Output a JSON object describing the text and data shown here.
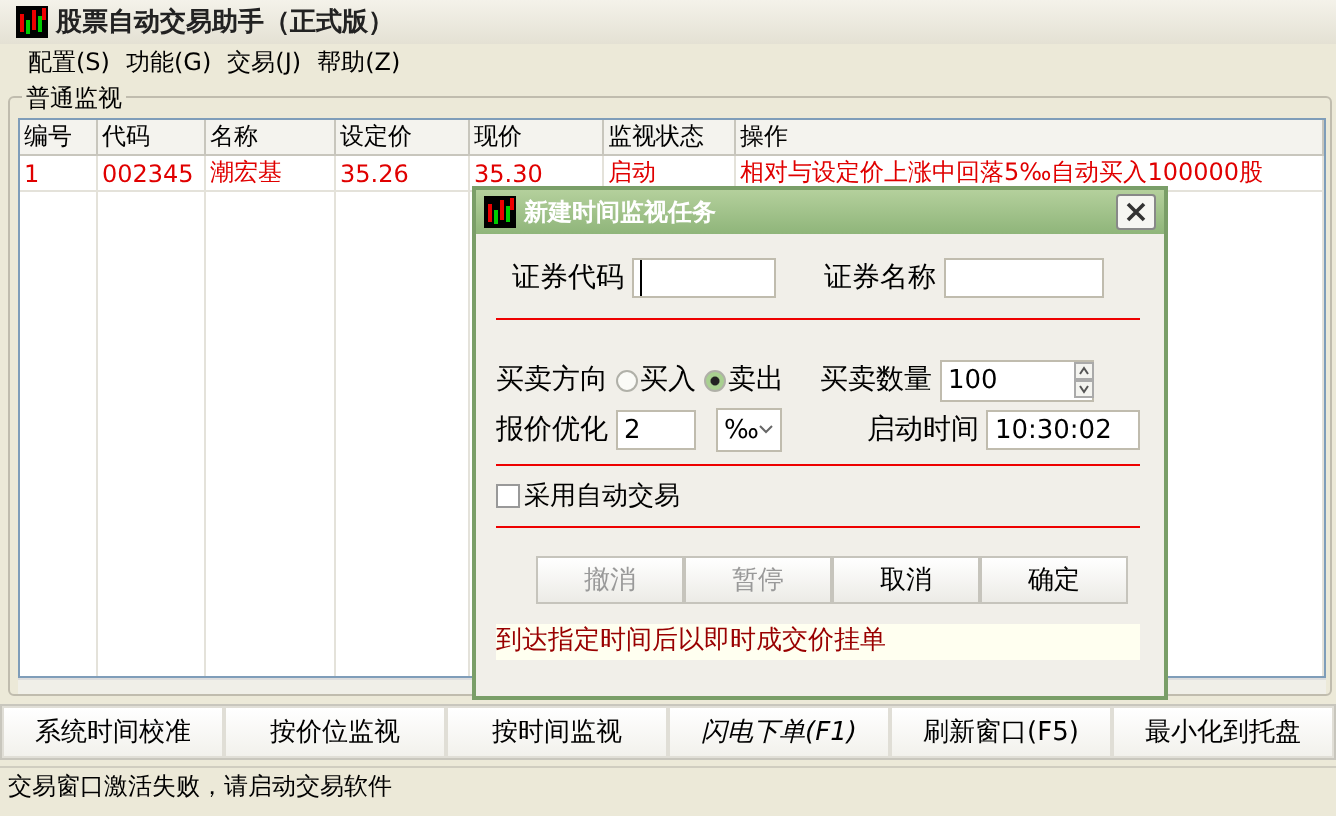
{
  "window": {
    "title": "股票自动交易助手（正式版）"
  },
  "menu": [
    "配置(S)",
    "功能(G)",
    "交易(J)",
    "帮助(Z)"
  ],
  "monitor_group": {
    "title": "普通监视",
    "table": {
      "columns": [
        "编号",
        "代码",
        "名称",
        "设定价",
        "现价",
        "监视状态",
        "操作"
      ],
      "rows": [
        {
          "selected": false,
          "cells": [
            "1",
            "002345",
            "潮宏基",
            "35.26",
            "35.30",
            "启动",
            "相对与设定价上涨中回落5‰自动买入100000股"
          ]
        }
      ]
    }
  },
  "dialog": {
    "title": "新建时间监视任务",
    "code": {
      "label": "证券代码"
    },
    "name": {
      "label": "证券名称"
    },
    "direction": {
      "label": "买卖方向",
      "options": [
        {
          "label": "买入",
          "selected": false
        },
        {
          "label": "卖出",
          "selected": true
        }
      ]
    },
    "quantity": {
      "label": "买卖数量",
      "value": "100"
    },
    "price_opt": {
      "label": "报价优化",
      "value": "2",
      "unit": "‰"
    },
    "start_time": {
      "label": "启动时间",
      "value": "10:30:02"
    },
    "auto_trade": {
      "label": "采用自动交易",
      "checked": false
    },
    "buttons": [
      {
        "label": "撤消",
        "disabled": true
      },
      {
        "label": "暂停",
        "disabled": true
      },
      {
        "label": "取消",
        "disabled": false
      },
      {
        "label": "确定",
        "disabled": false
      }
    ],
    "hint": "到达指定时间后以即时成交价挂单"
  },
  "bottom_buttons": [
    {
      "label": "系统时间校准",
      "italic": false
    },
    {
      "label": "按价位监视",
      "italic": false
    },
    {
      "label": "按时间监视",
      "italic": false
    },
    {
      "label": "闪电下单(F1)",
      "italic": true
    },
    {
      "label": "刷新窗口(F5)",
      "italic": false
    },
    {
      "label": "最小化到托盘",
      "italic": false
    }
  ],
  "status_bar": "交易窗口激活失败，请启动交易软件"
}
